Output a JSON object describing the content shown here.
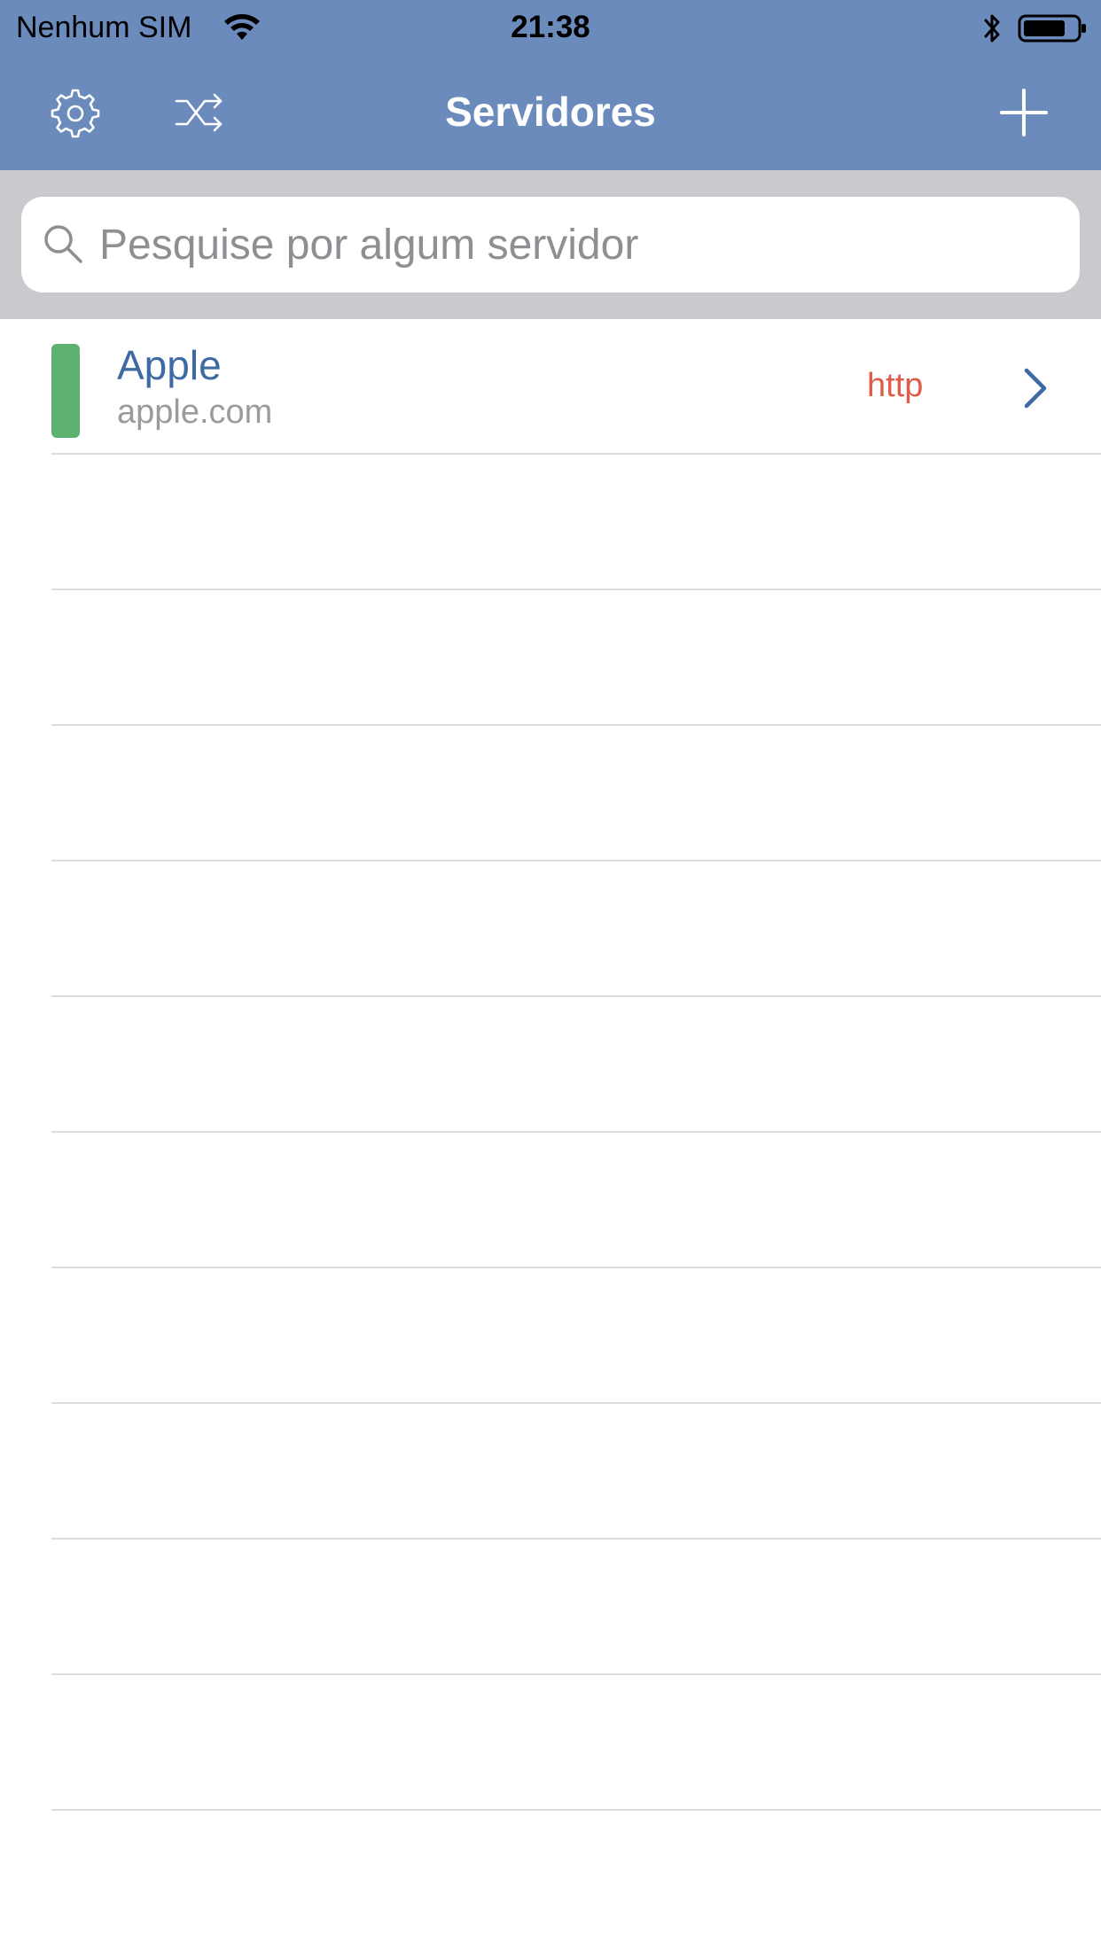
{
  "status_bar": {
    "carrier": "Nenhum SIM",
    "time": "21:38",
    "icons": [
      "wifi-icon",
      "bluetooth-icon",
      "battery-icon"
    ]
  },
  "nav": {
    "title": "Servidores",
    "left_icons": [
      "gear-icon",
      "shuffle-icon"
    ],
    "right_icon": "plus-icon",
    "bar_color": "#6b8bbd"
  },
  "search": {
    "placeholder": "Pesquise por algum servidor",
    "value": ""
  },
  "servers": [
    {
      "name": "Apple",
      "host": "apple.com",
      "protocol": "http",
      "status_color": "#5cb16f"
    }
  ],
  "colors": {
    "name_text": "#3e6aa3",
    "protocol_text": "#e05c4a",
    "host_text": "#9b9b9b",
    "search_background": "#c9c9ce"
  }
}
